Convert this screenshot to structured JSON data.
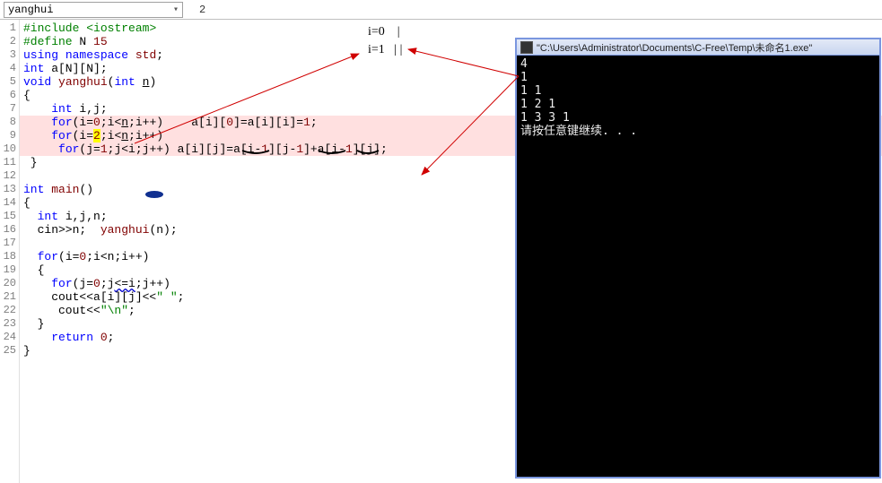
{
  "toolbar": {
    "combo_value": "yanghui",
    "page_indicator": "2"
  },
  "code_lines": [
    "#include <iostream>",
    "#define N 15",
    "using namespace std;",
    "int a[N][N];",
    "void yanghui(int n)",
    "{",
    "    int i,j;",
    "    for(i=0;i<n;i++)    a[i][0]=a[i][i]=1;",
    "    for(i=2;i<n;i++)",
    "     for(j=1;j<i;j++) a[i][j]=a[i-1][j-1]+a[i-1][j];",
    " }",
    "",
    "int main()",
    "{",
    "  int i,j,n;",
    "  cin>>n;  yanghui(n);",
    "",
    "  for(i=0;i<n;i++)",
    "  {",
    "    for(j=0;j<=i;j++)",
    "    cout<<a[i][j]<<\" \";",
    "     cout<<\"\\n\";",
    "  }",
    "    return 0;",
    "}"
  ],
  "highlighted_lines": [
    8,
    9,
    10
  ],
  "console": {
    "title": "\"C:\\Users\\Administrator\\Documents\\C-Free\\Temp\\未命名1.exe\"",
    "output": [
      "4",
      "1",
      "1 1",
      "1 2 1",
      "1 3 3 1",
      "请按任意键继续. . ."
    ]
  },
  "annotations": {
    "note1": "i=0    |",
    "note2": "i=1   | |"
  }
}
